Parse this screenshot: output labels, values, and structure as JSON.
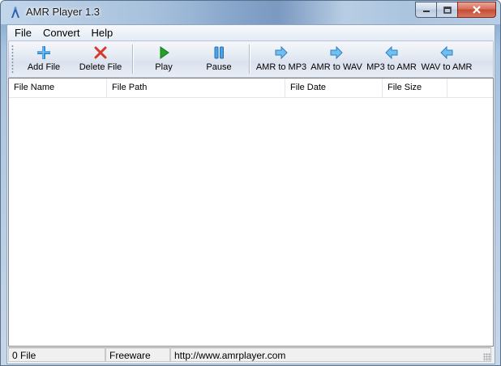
{
  "window": {
    "title": "AMR Player 1.3"
  },
  "menu": [
    "File",
    "Convert",
    "Help"
  ],
  "toolbar": {
    "buttons": [
      {
        "label": "Add File",
        "icon": "plus-icon"
      },
      {
        "label": "Delete File",
        "icon": "x-icon"
      },
      {
        "label": "Play",
        "icon": "play-icon"
      },
      {
        "label": "Pause",
        "icon": "pause-icon"
      },
      {
        "label": "AMR to MP3",
        "icon": "arrow-right-icon"
      },
      {
        "label": "AMR to WAV",
        "icon": "arrow-right-icon"
      },
      {
        "label": "MP3 to AMR",
        "icon": "arrow-left-icon"
      },
      {
        "label": "WAV to AMR",
        "icon": "arrow-left-icon"
      }
    ]
  },
  "list": {
    "columns": [
      "File Name",
      "File Path",
      "File Date",
      "File Size"
    ]
  },
  "status": {
    "count": "0 File",
    "license": "Freeware",
    "url": "http://www.amrplayer.com"
  },
  "colors": {
    "accent_blue": "#2f8fd8",
    "delete_red": "#d63a2c",
    "play_green": "#22a02a"
  }
}
